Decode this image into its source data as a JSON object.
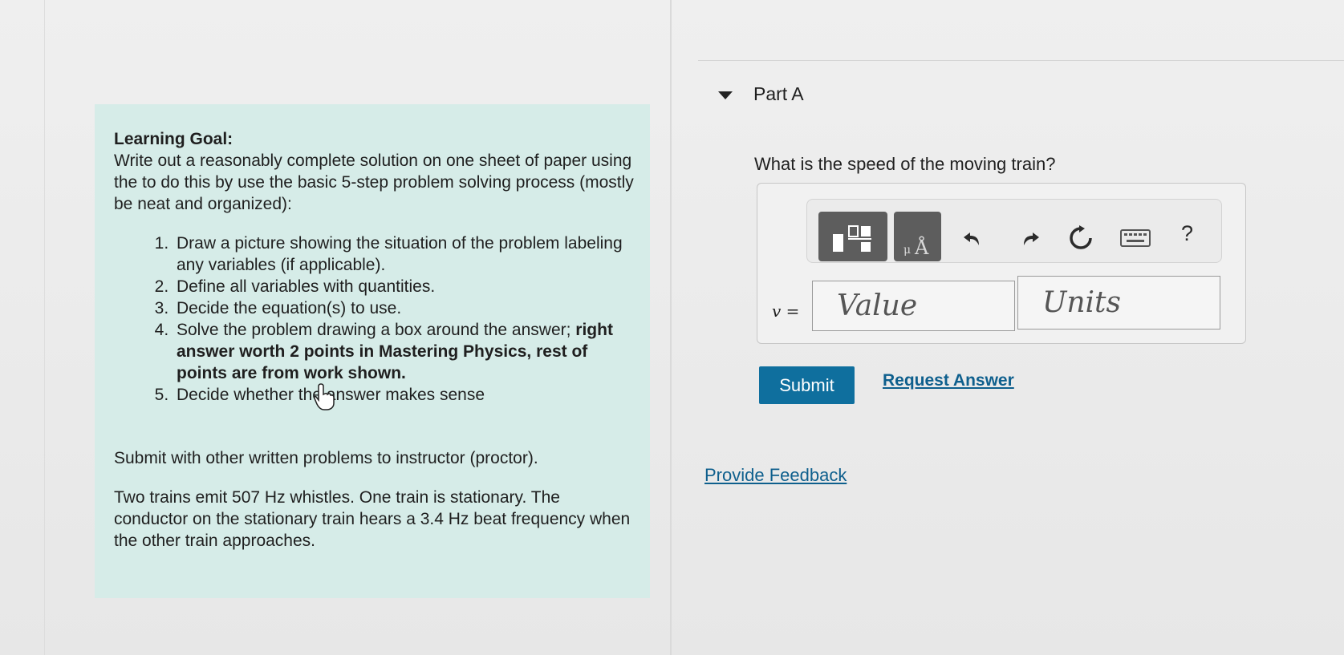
{
  "learning_goal": {
    "title": "Learning Goal:",
    "intro": "Write out a reasonably complete solution on one sheet of paper using the to do this by use the basic 5-step problem solving process (mostly be neat and organized):",
    "steps": [
      {
        "text": "Draw a picture showing the situation of the problem labeling any variables (if applicable)."
      },
      {
        "text": "Define all variables with quantities."
      },
      {
        "text": "Decide the equation(s) to use."
      },
      {
        "text": "Solve the problem drawing a box around the answer; ",
        "bold": "right answer worth 2 points in Mastering Physics, rest of points are from work shown."
      },
      {
        "text": "Decide whether the answer makes sense"
      }
    ],
    "submit_note": "Submit with other written problems to instructor (proctor).",
    "problem": "Two trains emit 507 Hz whistles. One train is stationary. The conductor on the stationary train hears a 3.4 Hz beat frequency when the other train approaches."
  },
  "part_a": {
    "header": "Part A",
    "question": "What is the speed of the moving train?",
    "variable": "v",
    "equals": "=",
    "value_placeholder": "Value",
    "units_placeholder": "Units",
    "toolbar": {
      "templates_icon": "fraction-template-icon",
      "units_icon": "units-angstrom-icon",
      "undo_icon": "undo-icon",
      "redo_icon": "redo-icon",
      "reset_icon": "reset-icon",
      "keyboard_icon": "keyboard-icon",
      "help_label": "?"
    },
    "submit_label": "Submit",
    "request_answer_label": "Request Answer",
    "feedback_label": "Provide Feedback"
  }
}
